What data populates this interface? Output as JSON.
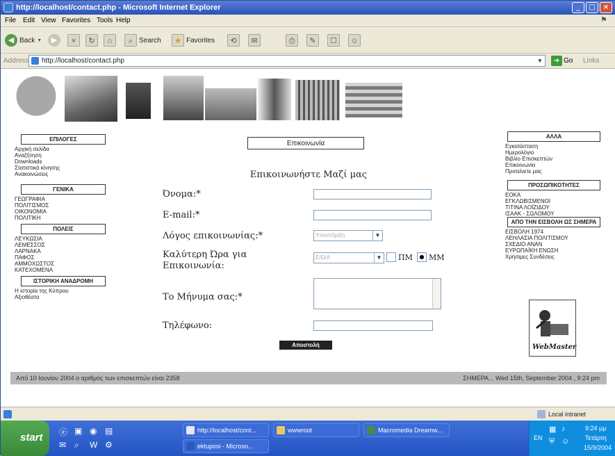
{
  "window": {
    "title": "http://localhost/contact.php - Microsoft Internet Explorer",
    "controls": [
      "_",
      "□",
      "×"
    ]
  },
  "menu": [
    "File",
    "Edit",
    "View",
    "Favorites",
    "Tools",
    "Help"
  ],
  "toolbar": {
    "back": "Back",
    "search": "Search",
    "favorites": "Favorites"
  },
  "address": {
    "label": "Address",
    "url": "http://localhost/contact.php",
    "go": "Go",
    "links": "Links"
  },
  "left_nav": {
    "sections": [
      {
        "title": "ΕΠΙΛΟΓΕΣ",
        "items": [
          "Αρχική σελίδα",
          "Αναζήτηση",
          "Downloads",
          "Στατιστικά κίνησης",
          "Ανακοινώσεις"
        ]
      },
      {
        "title": "ΓΕΝΙΚΑ",
        "items": [
          "ΓΕΩΓΡΑΦΙΑ",
          "ΠΟΛΙΤΙΣΜΟΣ",
          "ΟΙΚΟΝΟΜΙΑ",
          "ΠΟΛΙΤΙΚΗ"
        ]
      },
      {
        "title": "ΠΟΛΕΙΣ",
        "items": [
          "ΛΕΥΚΩΣΙΑ",
          "ΛΕΜΕΣΣΟΣ",
          "ΛΑΡΝΑΚΑ",
          "ΠΑΦΟΣ",
          "ΑΜΜΟΧΩΣΤΟΣ",
          "ΚΑΤΕΧΟΜΕΝΑ"
        ]
      },
      {
        "title": "ΙΣΤΟΡΙΚΗ ΑΝΑΔΡΟΜΗ",
        "items": [
          "Η ιστορία της Κύπρου",
          "Αξιοθέατα"
        ]
      }
    ]
  },
  "right_nav": {
    "sections": [
      {
        "title": "ΑΛΛΑ",
        "items": [
          "Εγκατάσταση",
          "Ημερολόγιο",
          "Βιβλίο Επισκεπτών",
          "Επικοινωνία",
          "Προτείνετε μας"
        ]
      },
      {
        "title": "ΠΡΟΣΩΠΙΚΟΤΗΤΕΣ",
        "items": [
          "ΕΟΚΑ",
          "ΕΓΚΛΩΒΙΣΜΕΝΟΙ",
          "ΤΙΤΙΝΑ ΛΟΪΖΙΔΟΥ",
          "ΙΣΑΑΚ - ΣΩΛΟΜΟΥ"
        ]
      },
      {
        "title": "ΑΠΟ ΤΗΝ ΕΙΣΒΟΛΗ ΩΣ ΣΗΜΕΡΑ",
        "items": [
          "ΕΙΣΒΟΛΗ 1974",
          "ΛΕΗΛΑΣΙΑ ΠΟΛΙΤΙΣΜΟΥ",
          "ΣΧΕΔΙΟ ΑΝΑΝ",
          "ΕΥΡΩΠΑΪΚΗ ΕΝΩΣΗ",
          "Χρήσιμες Συνδέσεις"
        ]
      }
    ],
    "webmaster_label": "WebMaster"
  },
  "main": {
    "tab_label": "Επικοινωνία",
    "heading": "Επικοινωνήστε Μαζί μας",
    "fields": {
      "name_label": "Όνομα:*",
      "email_label": "E-mail:*",
      "reason_label": "Λόγος επικοινωνίας:*",
      "reason_value": "Υποστήριξη",
      "time_label_1": "Καλύτερη Ώρα για",
      "time_label_2": "Επικοινωνία:",
      "time_value": "Ε/Ω/Α",
      "pm_label": "ΠΜ",
      "mm_label": "ΜΜ",
      "message_label": "Το Μήνυμα σας:*",
      "phone_label": "Τηλέφωνο:"
    },
    "submit": "Αποστολή"
  },
  "footer": {
    "visits": "Από 10 Ιουνίου 2004 ο αριθμός των επισκεπτών είναι 2358",
    "today": "ΣΗΜΕΡΑ... Wed 15th, September 2004 , 9:24 pm"
  },
  "statusbar": {
    "zone": "Local intranet"
  },
  "taskbar": {
    "start": "start",
    "tasks": [
      "http://localhost/cont...",
      "wwwroot",
      "Macromedia Dreamw...",
      "ektuposi - Microso..."
    ],
    "lang": "EN",
    "clock": "9:24 μμ",
    "day": "Τετάρτη",
    "date": "15/9/2004"
  }
}
